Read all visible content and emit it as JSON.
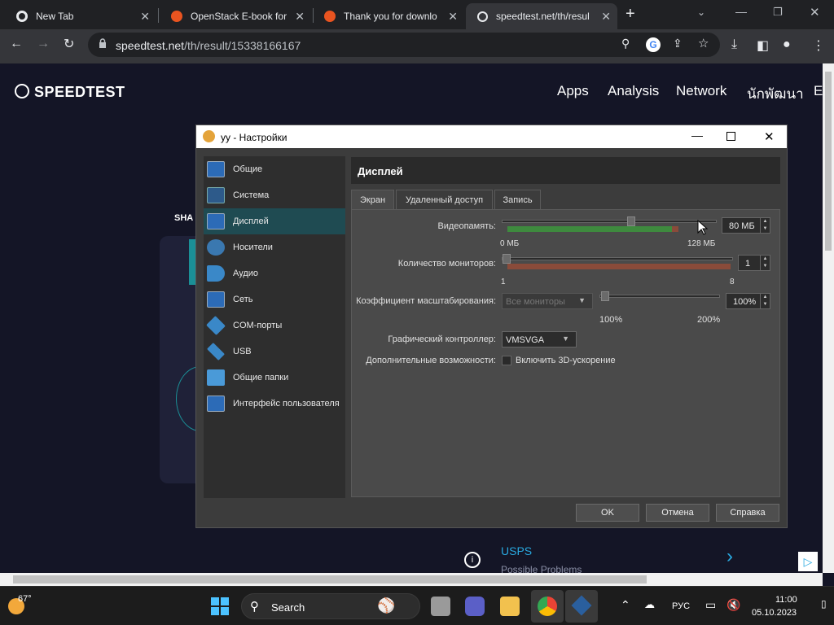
{
  "browser": {
    "tabs": [
      {
        "title": "New Tab",
        "icon": "chrome-icon"
      },
      {
        "title": "OpenStack E-book for",
        "icon": "ubuntu-icon"
      },
      {
        "title": "Thank you for downlo",
        "icon": "ubuntu-icon"
      },
      {
        "title": "speedtest.net/th/resul",
        "icon": "speedtest-icon"
      }
    ],
    "new_tab": "+",
    "url_domain": "speedtest.net",
    "url_path": "/th/result/15338166167"
  },
  "page": {
    "logo": "SPEEDTEST",
    "nav": [
      "Apps",
      "Analysis",
      "Network",
      "นักพัฒนา",
      "E"
    ],
    "share_partial": "SHA",
    "ad_title": "USPS",
    "ad_sub": "Possible Problems"
  },
  "dialog": {
    "title": "yy - Настройки",
    "sidebar": [
      {
        "label": "Общие",
        "icon": "general-icon"
      },
      {
        "label": "Система",
        "icon": "system-icon"
      },
      {
        "label": "Дисплей",
        "icon": "display-icon",
        "selected": true
      },
      {
        "label": "Носители",
        "icon": "storage-icon"
      },
      {
        "label": "Аудио",
        "icon": "audio-icon"
      },
      {
        "label": "Сеть",
        "icon": "network-icon"
      },
      {
        "label": "COM-порты",
        "icon": "serial-ports-icon"
      },
      {
        "label": "USB",
        "icon": "usb-icon"
      },
      {
        "label": "Общие папки",
        "icon": "shared-folders-icon"
      },
      {
        "label": "Интерфейс пользователя",
        "icon": "user-interface-icon"
      }
    ],
    "section_title": "Дисплей",
    "tabs": [
      "Экран",
      "Удаленный доступ",
      "Запись"
    ],
    "video_memory": {
      "label": "Видеопамять:",
      "value": "80 МБ",
      "min": "0 МБ",
      "max": "128 МБ",
      "level": 0.625
    },
    "monitors": {
      "label": "Количество мониторов:",
      "value": "1",
      "min": "1",
      "max": "8"
    },
    "scale": {
      "label": "Коэффициент масштабирования:",
      "combo": "Все мониторы",
      "value": "100%",
      "min": "100%",
      "max": "200%"
    },
    "controller": {
      "label": "Графический контроллер:",
      "value": "VMSVGA"
    },
    "extra": {
      "label": "Дополнительные возможности:",
      "checkbox": "Включить 3D-ускорение"
    },
    "buttons": {
      "ok": "OK",
      "cancel": "Отмена",
      "help": "Справка"
    }
  },
  "taskbar": {
    "weather_temp": "67°",
    "search": "Search",
    "lang": "РУС",
    "time": "11:00",
    "date": "05.10.2023"
  },
  "colors": {
    "page_bg": "#141526",
    "sidebar_selected": "#1f4b52",
    "memory_band_green": "#3e8a3e",
    "band_red": "#8a4b3a"
  }
}
